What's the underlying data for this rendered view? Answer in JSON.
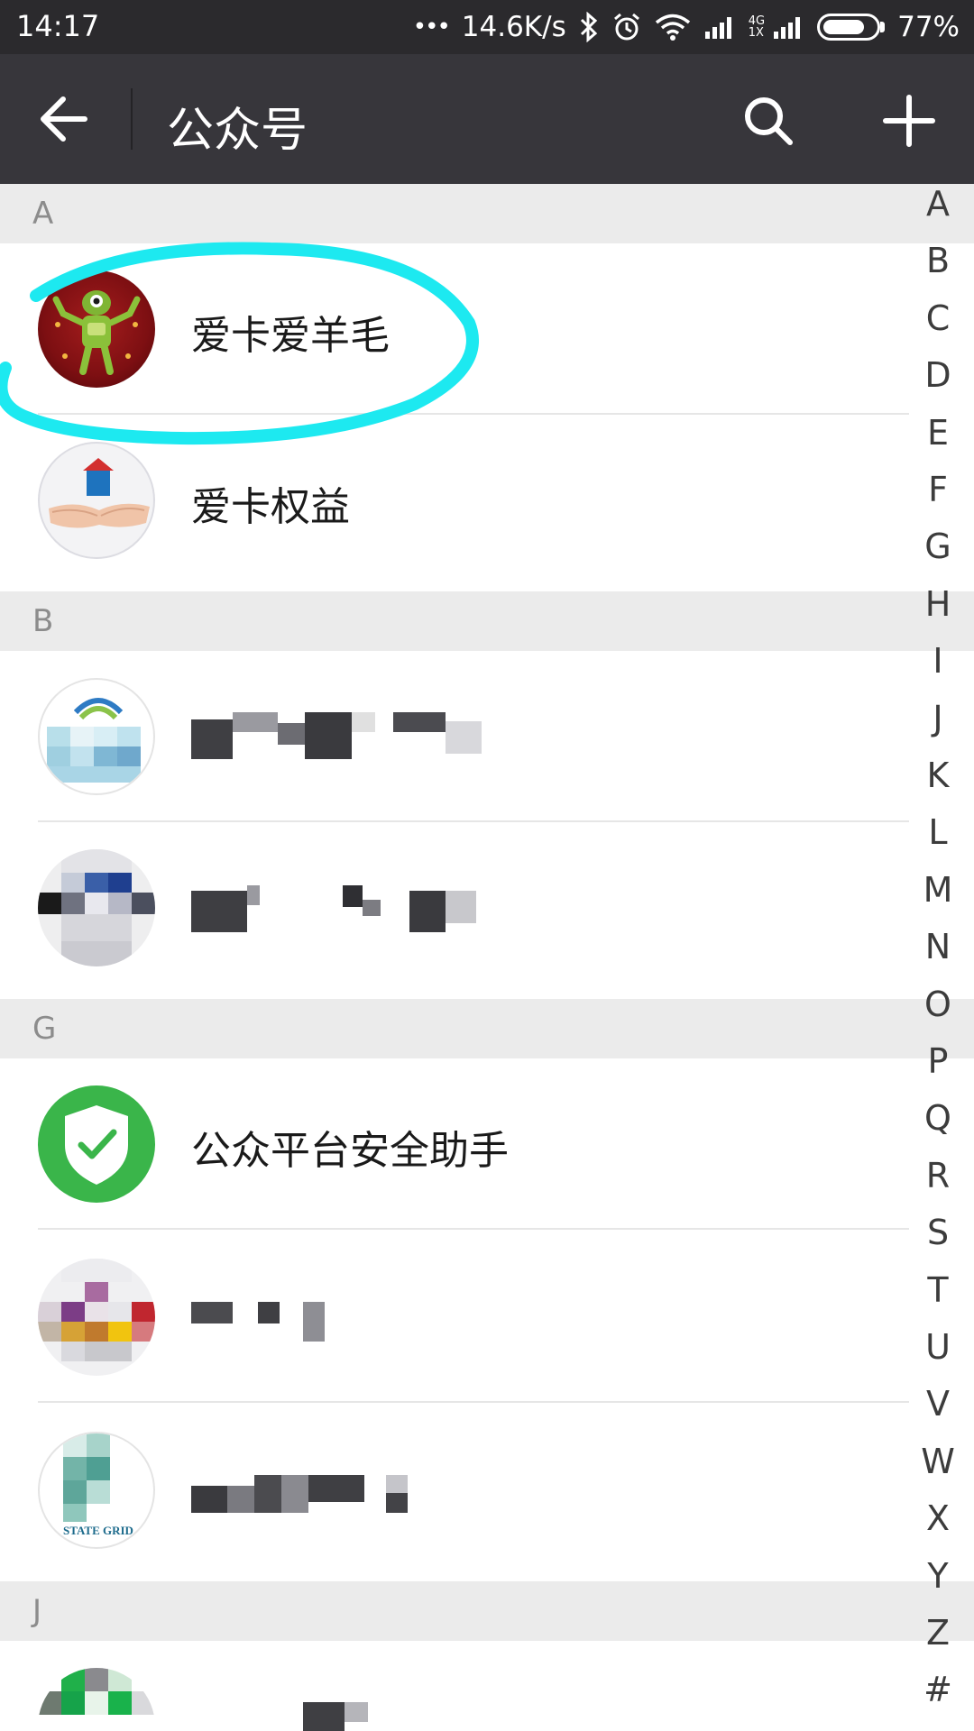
{
  "status_bar": {
    "time": "14:17",
    "dots": "•••",
    "speed": "14.6K/s",
    "net_top": "4G",
    "net_bottom": "1X",
    "battery": "77%",
    "battery_level": 0.77
  },
  "header": {
    "title": "公众号",
    "back_icon": "arrow-left-icon",
    "search_icon": "search-icon",
    "add_icon": "plus-icon"
  },
  "sections": [
    {
      "letter": "A",
      "items": [
        {
          "name": "爱卡爱羊毛",
          "avatar": "robot-avatar"
        },
        {
          "name": "爱卡权益",
          "avatar": "house-in-hands-avatar"
        }
      ]
    },
    {
      "letter": "B",
      "items": [
        {
          "name": "",
          "avatar": "pixelated-avatar"
        },
        {
          "name": "",
          "avatar": "pixelated-avatar"
        }
      ]
    },
    {
      "letter": "G",
      "items": [
        {
          "name": "公众平台安全助手",
          "avatar": "shield-check-avatar"
        },
        {
          "name": "",
          "avatar": "pixelated-avatar"
        },
        {
          "name": "",
          "avatar": "pixelated-avatar",
          "avatar_text": "STATE GRID"
        }
      ]
    },
    {
      "letter": "J",
      "items": [
        {
          "name": "",
          "avatar": "pixelated-avatar"
        }
      ]
    }
  ],
  "alphabet_index": [
    "A",
    "B",
    "C",
    "D",
    "E",
    "F",
    "G",
    "H",
    "I",
    "J",
    "K",
    "L",
    "M",
    "N",
    "O",
    "P",
    "Q",
    "R",
    "S",
    "T",
    "U",
    "V",
    "W",
    "X",
    "Y",
    "Z",
    "#"
  ],
  "colors": {
    "header_bg": "#37363b",
    "status_bg": "#2b2a2d",
    "section_bg": "#ebebeb",
    "highlight": "#1de9f0",
    "shield_green": "#3ab54a"
  }
}
